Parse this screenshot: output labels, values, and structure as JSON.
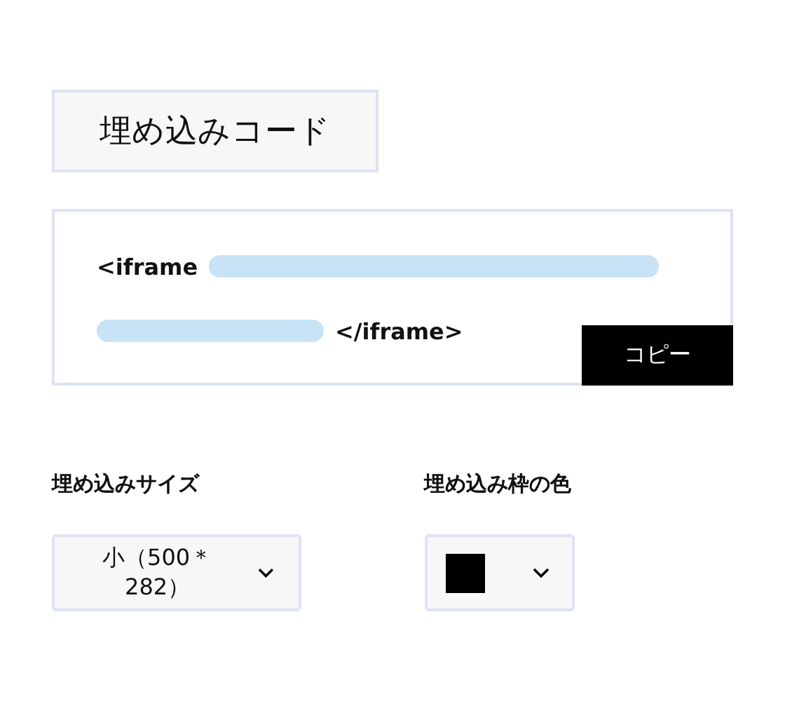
{
  "title": "埋め込みコード",
  "code": {
    "start": "<iframe",
    "end": "</iframe>"
  },
  "copy_button": "コピー",
  "size": {
    "label": "埋め込みサイズ",
    "value": "小（500＊282）"
  },
  "frame_color": {
    "label": "埋め込み枠の色",
    "color": "#000000"
  }
}
